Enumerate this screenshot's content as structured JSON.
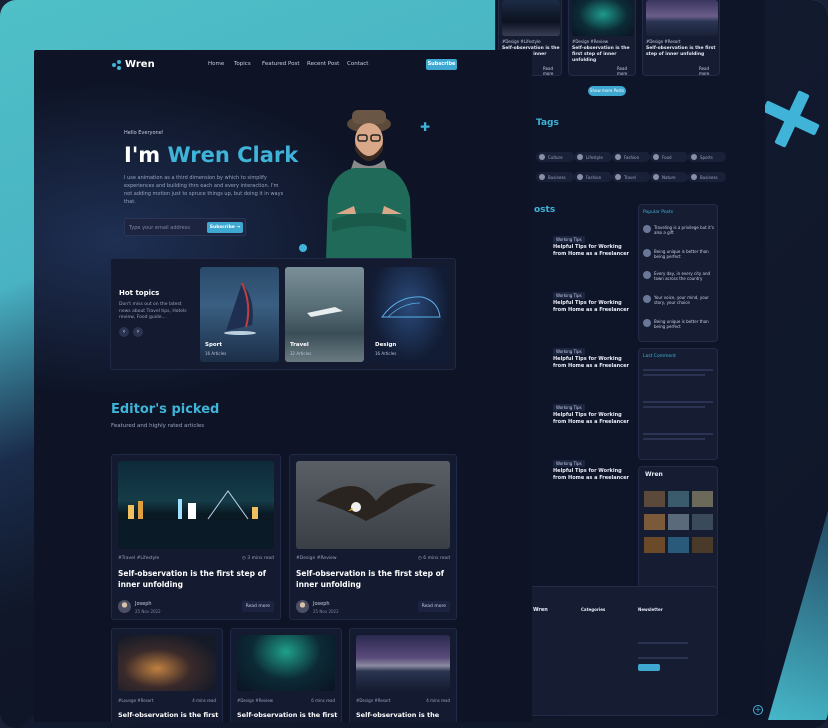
{
  "nav": {
    "logo": "Wren",
    "links": [
      "Home",
      "Topics",
      "Featured Post",
      "Recent Post",
      "Contact"
    ],
    "subscribe": "Subscribe"
  },
  "hero": {
    "greeting": "Hello Everyone!",
    "title_prefix": "I'm ",
    "title_name": "Wren Clark",
    "description": "I use animation as a third dimension by which to simplify experiences and building thro each and every interaction. I'm not adding motion just to spruce things up, but doing it in ways that.",
    "email_placeholder": "Type your email address",
    "email_button": "Subscribe"
  },
  "topics": {
    "title": "Hot topics",
    "description": "Don't miss out on the latest news about Travel tips, Hotels review, Food guide...",
    "cards": [
      {
        "label": "Sport",
        "count": "16 Articles"
      },
      {
        "label": "Travel",
        "count": "32 Articles"
      },
      {
        "label": "Design",
        "count": "16 Articles"
      }
    ]
  },
  "editors": {
    "title": "Editor's picked",
    "subtitle": "Featured and highly rated articles"
  },
  "posts": [
    {
      "tags": "#Travel #Lifestyle",
      "read": "3 mins read",
      "title": "Self-observation is the first step of inner unfolding",
      "author": "Joseph",
      "date": "25 Nov 2022",
      "read_more": "Read more"
    },
    {
      "tags": "#Design #Review",
      "read": "6 mins read",
      "title": "Self-observation is the first step of inner unfolding",
      "author": "Joseph",
      "date": "25 Nov 2022",
      "read_more": "Read more"
    }
  ],
  "small_posts": [
    {
      "tags": "#Lounge #Resort",
      "read": "4 mins read",
      "title": "Self-observation is the first"
    },
    {
      "tags": "#Design #Review",
      "read": "6 mins read",
      "title": "Self-observation is the first"
    },
    {
      "tags": "#Design #Resort",
      "read": "4 mins read",
      "title": "Self-observation is the first"
    }
  ],
  "back_page": {
    "top_posts": [
      {
        "title": "Self-observation is the first step of inner unfolding",
        "read_more": "Read more"
      },
      {
        "title": "Self-observation is the first step of inner unfolding",
        "read_more": "Read more"
      },
      {
        "title": "Self-observation is the first step of inner unfolding",
        "read_more": "Read more"
      }
    ],
    "show_more": "Show more Posts",
    "tags_heading": "Tags",
    "tag_chips": [
      "Culture",
      "Lifestyle",
      "Fashion",
      "Food",
      "Sports",
      "Business",
      "Fashion",
      "Travel",
      "Nature",
      "Business"
    ],
    "recent_heading": "osts",
    "recent_posts": [
      {
        "tag": "Working Tips",
        "title": "Helpful Tips for Working from Home as a Freelancer"
      },
      {
        "tag": "Working Tips",
        "title": "Helpful Tips for Working from Home as a Freelancer"
      },
      {
        "tag": "Working Tips",
        "title": "Helpful Tips for Working from Home as a Freelancer"
      },
      {
        "tag": "Working Tips",
        "title": "Helpful Tips for Working from Home as a Freelancer"
      },
      {
        "tag": "Working Tips",
        "title": "Helpful Tips for Working from Home as a Freelancer"
      }
    ],
    "popular_heading": "Popular Posts",
    "popular": [
      "Traveling is a privilege but it's also a gift",
      "Being unique is better than being perfect",
      "Every day, in every city and town across the country",
      "Your voice, your mind, your story, your choice",
      "Being unique is better than being perfect"
    ],
    "comment_heading": "Last Comment",
    "gallery_logo": "Wren",
    "newsletter_heading": "Newsletter",
    "footer_logo": "Wren",
    "categories_heading": "Categories"
  },
  "colors": {
    "accent": "#3fb4d8",
    "button": "#3fa8d0",
    "page_bg": "#0e1426",
    "card_bg": "#141b31"
  }
}
